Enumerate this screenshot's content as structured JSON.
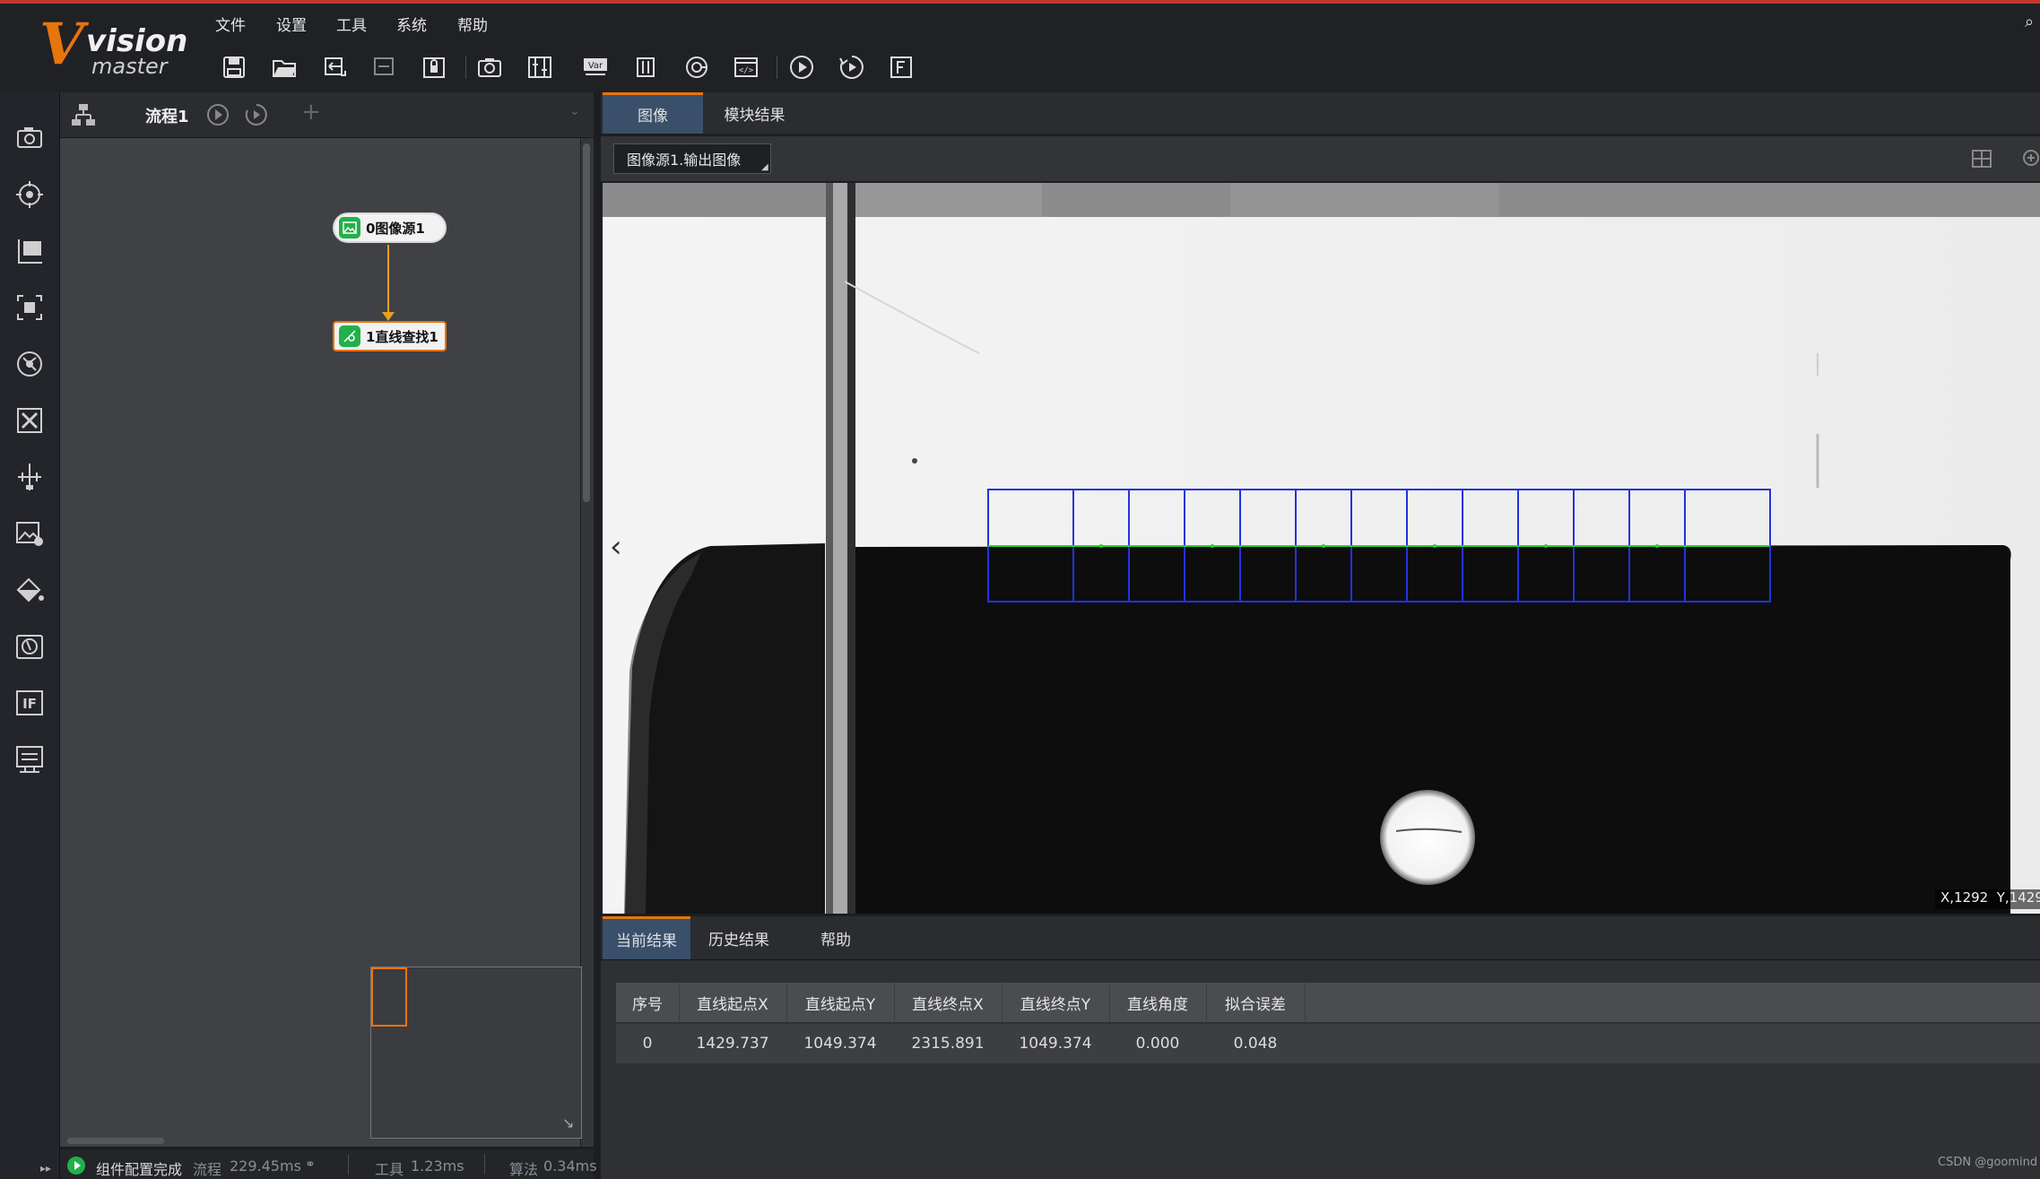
{
  "app": {
    "logo_line1": "vision",
    "logo_line2": "master"
  },
  "menu": [
    "文件",
    "设置",
    "工具",
    "系统",
    "帮助"
  ],
  "toolbar_icons": [
    "save-icon",
    "open-folder-icon",
    "import-icon",
    "export-icon",
    "lock-icon",
    "camera-icon",
    "controller-icon",
    "variable-icon",
    "communication-icon",
    "global-script-icon",
    "code-icon",
    "run-once-icon",
    "run-loop-icon",
    "function-icon"
  ],
  "left_tools": [
    "acquisition-icon",
    "locate-icon",
    "measure-icon",
    "recognition-icon",
    "calibration-icon",
    "align-icon",
    "measure-ruler-icon",
    "image-process-icon",
    "color-icon",
    "defect-icon",
    "logic-if-icon",
    "communication-tool-icon"
  ],
  "flow": {
    "tab_label": "流程1",
    "add_symbol": "+",
    "nodes": [
      {
        "label": "0图像源1",
        "icon": "image-icon"
      },
      {
        "label": "1直线查找1",
        "icon": "line-find-icon"
      }
    ]
  },
  "status": {
    "text": "组件配置完成",
    "flow_label": "流程",
    "flow_time": "229.45ms",
    "tool_label": "工具",
    "tool_time": "1.23ms",
    "algo_label": "算法",
    "algo_time": "0.34ms"
  },
  "image_tabs": [
    "图像",
    "模块结果"
  ],
  "image_source": "图像源1.输出图像",
  "coords": "X,1292  Y,1429",
  "result_tabs": [
    "当前结果",
    "历史结果",
    "帮助"
  ],
  "table": {
    "headers": [
      "序号",
      "直线起点X",
      "直线起点Y",
      "直线终点X",
      "直线终点Y",
      "直线角度",
      "拟合误差"
    ],
    "rows": [
      [
        "0",
        "1429.737",
        "1049.374",
        "2315.891",
        "1049.374",
        "0.000",
        "0.048"
      ]
    ]
  },
  "watermark": "CSDN @goomind",
  "colors": {
    "accent": "#e8740c",
    "node_green": "#22b04a",
    "roi_blue": "#1f2fd6",
    "line_green": "#2bd12b",
    "top_border": "#c0392b"
  }
}
